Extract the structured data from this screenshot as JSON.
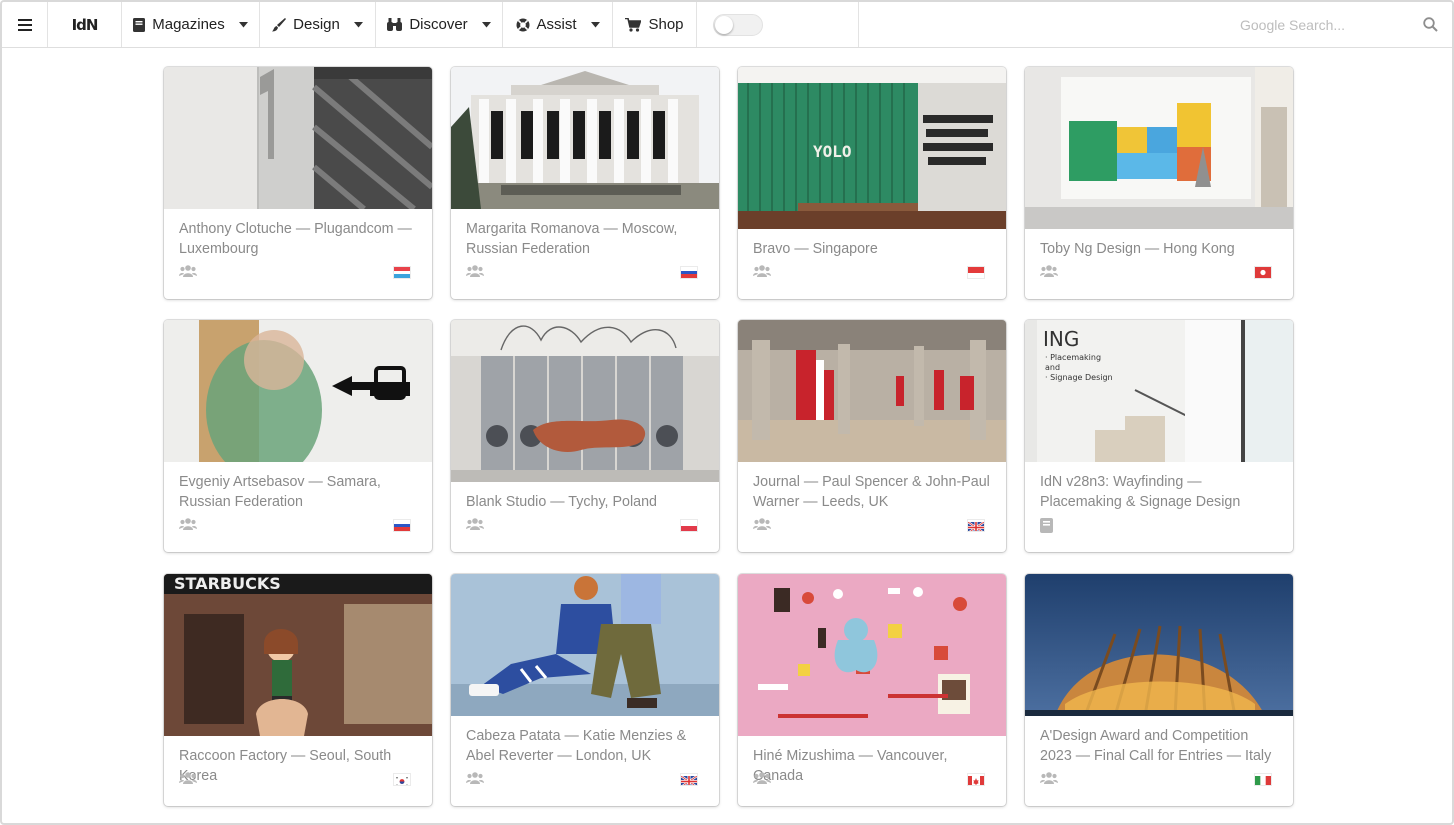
{
  "nav": {
    "logo": "IdN",
    "items": [
      {
        "label": "Magazines",
        "icon": "book-icon"
      },
      {
        "label": "Design",
        "icon": "brush-icon"
      },
      {
        "label": "Discover",
        "icon": "binoculars-icon"
      },
      {
        "label": "Assist",
        "icon": "lifebuoy-icon"
      },
      {
        "label": "Shop",
        "icon": "cart-icon"
      }
    ],
    "search_placeholder": "Google Search..."
  },
  "cards": [
    {
      "caption": "Anthony Clotuche — Plugandcom — Luxembourg",
      "meta": "users-icon",
      "flag": "luxembourg"
    },
    {
      "caption": "Margarita Romanova — Moscow, Russian Federation",
      "meta": "users-icon",
      "flag": "russia"
    },
    {
      "caption": "Bravo — Singapore",
      "meta": "users-icon",
      "flag": "singapore"
    },
    {
      "caption": "Toby Ng Design — Hong Kong",
      "meta": "users-icon",
      "flag": "hong-kong"
    },
    {
      "caption": "Evgeniy Artsebasov — Samara, Russian Federation",
      "meta": "users-icon",
      "flag": "russia"
    },
    {
      "caption": "Blank Studio — Tychy, Poland",
      "meta": "users-icon",
      "flag": "poland"
    },
    {
      "caption": "Journal — Paul Spencer & John-Paul Warner — Leeds, UK",
      "meta": "users-icon",
      "flag": "uk"
    },
    {
      "caption": "IdN v28n3: Wayfinding — Placemaking & Signage Design",
      "meta": "book-icon",
      "flag": ""
    },
    {
      "caption": "Raccoon Factory — Seoul, South Korea",
      "meta": "users-icon",
      "flag": "south-korea"
    },
    {
      "caption": "Cabeza Patata — Katie Menzies & Abel Reverter — London, UK",
      "meta": "users-icon",
      "flag": "uk"
    },
    {
      "caption": "Hiné Mizushima — Vancouver, Canada",
      "meta": "users-icon",
      "flag": "canada"
    },
    {
      "caption": "A'Design Award and Competition 2023 — Final Call for Entries — Italy",
      "meta": "users-icon",
      "flag": "italy"
    }
  ]
}
